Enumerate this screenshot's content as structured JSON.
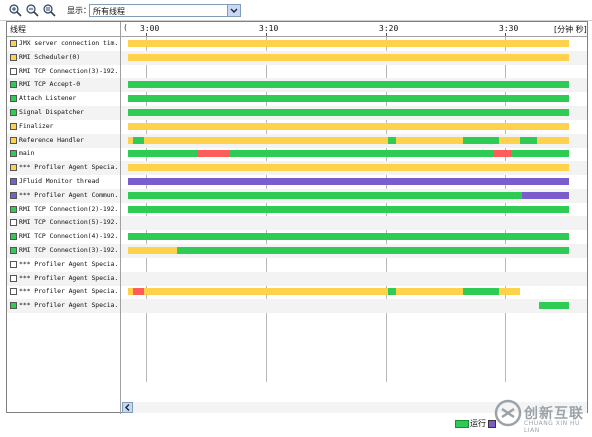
{
  "toolbar": {
    "icons": [
      "zoom-in-icon",
      "zoom-out-icon",
      "zoom-fit-icon"
    ],
    "show_label": "显示：",
    "filter_value": "所有线程"
  },
  "header": {
    "thread_col": "线程",
    "ticks": [
      "3:00",
      "3:10",
      "3:20",
      "3:30"
    ],
    "unit": "[分钟 秒]"
  },
  "colors": {
    "running": "#2ecc55",
    "sleeping": "#ffd24d",
    "wait": "#7a5ccc",
    "monitor": "#ff5c5c"
  },
  "timeline": {
    "visible_range_s": [
      177.5,
      215.5
    ],
    "threads": [
      {
        "name": "JMX server connection tim...",
        "swatch": "sleeping",
        "segments": [
          [
            178,
            214,
            "sleeping"
          ]
        ]
      },
      {
        "name": "RMI Scheduler(0)",
        "swatch": "sleeping",
        "segments": [
          [
            178,
            214,
            "sleeping"
          ]
        ]
      },
      {
        "name": "RMI TCP Connection(3)-192...",
        "swatch": "none",
        "segments": []
      },
      {
        "name": "RMI TCP Accept-0",
        "swatch": "running",
        "segments": [
          [
            178,
            214,
            "running"
          ]
        ]
      },
      {
        "name": "Attach Listener",
        "swatch": "running",
        "segments": [
          [
            178,
            214,
            "running"
          ]
        ]
      },
      {
        "name": "Signal Dispatcher",
        "swatch": "running",
        "segments": [
          [
            178,
            214,
            "running"
          ]
        ]
      },
      {
        "name": "Finalizer",
        "swatch": "sleeping",
        "segments": [
          [
            178,
            214,
            "sleeping"
          ]
        ]
      },
      {
        "name": "Reference Handler",
        "swatch": "sleeping",
        "segments": [
          [
            178,
            178.4,
            "sleeping"
          ],
          [
            178.4,
            179.3,
            "running"
          ],
          [
            179.3,
            199.2,
            "sleeping"
          ],
          [
            199.2,
            199.9,
            "running"
          ],
          [
            199.9,
            205.4,
            "sleeping"
          ],
          [
            205.4,
            208.3,
            "running"
          ],
          [
            208.3,
            210,
            "sleeping"
          ],
          [
            210,
            211.4,
            "running"
          ],
          [
            211.4,
            214,
            "sleeping"
          ]
        ]
      },
      {
        "name": "main",
        "swatch": "running",
        "segments": [
          [
            178,
            183.7,
            "running"
          ],
          [
            183.7,
            186.3,
            "monitor"
          ],
          [
            186.3,
            207.8,
            "running"
          ],
          [
            207.8,
            209.3,
            "monitor"
          ],
          [
            209.3,
            214,
            "running"
          ]
        ]
      },
      {
        "name": "*** Profiler Agent Specia...",
        "swatch": "sleeping",
        "segments": [
          [
            178,
            214,
            "sleeping"
          ]
        ]
      },
      {
        "name": "JFluid Monitor thread",
        "swatch": "wait",
        "segments": [
          [
            178,
            214,
            "wait"
          ]
        ]
      },
      {
        "name": "*** Profiler Agent Commun...",
        "swatch": "wait",
        "segments": [
          [
            178,
            210.2,
            "running"
          ],
          [
            210.2,
            214,
            "wait"
          ]
        ]
      },
      {
        "name": "RMI TCP Connection(2)-192...",
        "swatch": "running",
        "segments": [
          [
            178,
            214,
            "running"
          ]
        ]
      },
      {
        "name": "RMI TCP Connection(5)-192...",
        "swatch": "none",
        "segments": []
      },
      {
        "name": "RMI TCP Connection(4)-192...",
        "swatch": "running",
        "segments": [
          [
            178,
            214,
            "running"
          ]
        ]
      },
      {
        "name": "RMI TCP Connection(3)-192...",
        "swatch": "running",
        "segments": [
          [
            178,
            182,
            "sleeping"
          ],
          [
            182,
            214,
            "running"
          ]
        ]
      },
      {
        "name": "*** Profiler Agent Specia...",
        "swatch": "none",
        "segments": []
      },
      {
        "name": "*** Profiler Agent Specia...",
        "swatch": "none",
        "segments": []
      },
      {
        "name": "*** Profiler Agent Specia...",
        "swatch": "none",
        "segments": [
          [
            178,
            178.4,
            "sleeping"
          ],
          [
            178.4,
            179.3,
            "monitor"
          ],
          [
            179.3,
            199.2,
            "sleeping"
          ],
          [
            199.2,
            199.9,
            "running"
          ],
          [
            199.9,
            205.4,
            "sleeping"
          ],
          [
            205.4,
            208.3,
            "running"
          ],
          [
            208.3,
            210,
            "sleeping"
          ]
        ]
      },
      {
        "name": "*** Profiler Agent Specia...",
        "swatch": "running",
        "segments": [
          [
            211.6,
            214,
            "running"
          ]
        ]
      }
    ]
  },
  "legend": {
    "running_label": "运行"
  },
  "watermark": {
    "text": "创新互联",
    "sub": "CHUANG XIN HU LIAN"
  }
}
